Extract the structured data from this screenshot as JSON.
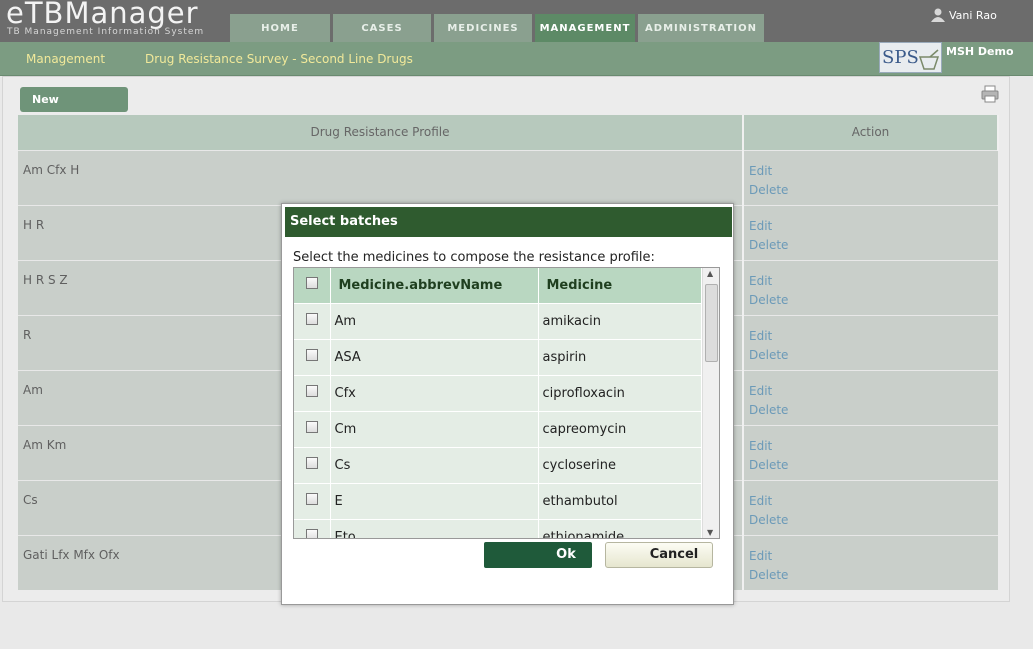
{
  "header": {
    "logo": "eTBManager",
    "logo_subtitle": "TB Management Information System",
    "tabs": [
      "HOME",
      "CASES",
      "MEDICINES",
      "MANAGEMENT",
      "ADMINISTRATION"
    ],
    "active_tab": "MANAGEMENT",
    "user_name": "Vani Rao"
  },
  "breadcrumb": {
    "section": "Management",
    "page": "Drug Resistance Survey - Second Line Drugs"
  },
  "branding": {
    "logo_text": "SPS",
    "workspace": "MSH Demo"
  },
  "toolbar": {
    "new_label": "New"
  },
  "grid": {
    "columns": [
      "Drug Resistance Profile",
      "Action"
    ],
    "rows": [
      "Am Cfx H",
      "H R",
      "H R S Z",
      "R",
      "Am",
      "Am Km",
      "Cs",
      "Gati Lfx Mfx Ofx"
    ],
    "edit_label": "Edit",
    "delete_label": "Delete"
  },
  "modal": {
    "title": "Select batches",
    "instruction": "Select the medicines to compose the resistance profile:",
    "columns": [
      "Medicine.abbrevName",
      "Medicine"
    ],
    "items": [
      {
        "abbrev": "Am",
        "name": "amikacin"
      },
      {
        "abbrev": "ASA",
        "name": "aspirin"
      },
      {
        "abbrev": "Cfx",
        "name": "ciprofloxacin"
      },
      {
        "abbrev": "Cm",
        "name": "capreomycin"
      },
      {
        "abbrev": "Cs",
        "name": "cycloserine"
      },
      {
        "abbrev": "E",
        "name": "ethambutol"
      },
      {
        "abbrev": "Eto",
        "name": "ethionamide"
      }
    ],
    "ok_label": "Ok",
    "cancel_label": "Cancel"
  },
  "colors": {
    "header_bg": "#6c6c6c",
    "subnav_bg": "#7c9c82",
    "modal_head": "#2f5b2f",
    "link": "#6b9ab8",
    "ok_button": "#1f5a3a"
  }
}
